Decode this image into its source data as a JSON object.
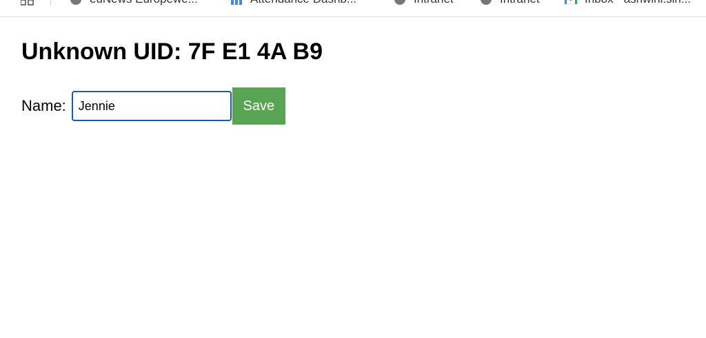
{
  "bookmarks_bar": {
    "items": [
      {
        "label": "euNews Europewe...",
        "icon": "globe-icon"
      },
      {
        "label": "Attendance Dashb...",
        "icon": "dashboard-icon"
      },
      {
        "label": "Intranet",
        "icon": "globe-icon"
      },
      {
        "label": "Intranet",
        "icon": "globe-icon"
      },
      {
        "label": "Inbox - ashwini.sin...",
        "icon": "gmail-icon"
      }
    ]
  },
  "page": {
    "title": "Unknown UID: 7F E1 4A B9"
  },
  "form": {
    "name_label": "Name:",
    "name_value": "Jennie",
    "save_label": "Save"
  },
  "colors": {
    "save_button": "#57a553",
    "input_focus_border": "#1a5aa8"
  }
}
